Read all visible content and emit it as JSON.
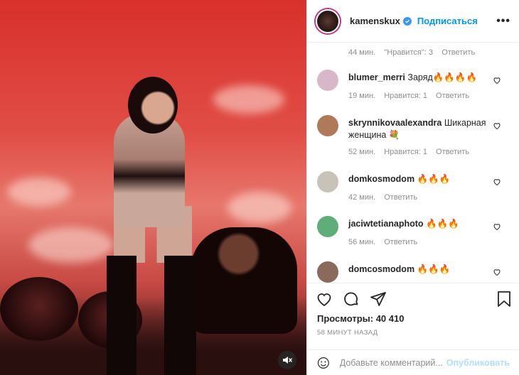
{
  "header": {
    "username": "kamenskux",
    "follow_label": "Подписаться",
    "more_label": "•••"
  },
  "comments_top_meta": {
    "time": "44 мин.",
    "likes": "\"Нравится\": 3",
    "reply": "Ответить"
  },
  "comments": [
    {
      "username": "blumer_merri",
      "text": "Заряд🔥🔥🔥🔥",
      "time": "19 мин.",
      "likes": "Нравится: 1",
      "reply": "Ответить",
      "avatar_color": "#d8b8c8"
    },
    {
      "username": "skrynnikovaalexandra",
      "text": "Шикарная женщина 💐",
      "time": "52 мин.",
      "likes": "Нравится: 1",
      "reply": "Ответить",
      "avatar_color": "#b07a5a"
    },
    {
      "username": "domkosmodom",
      "text": "🔥🔥🔥",
      "time": "42 мин.",
      "likes": "",
      "reply": "Ответить",
      "avatar_color": "#c9c2b8"
    },
    {
      "username": "jaciwtetianaphoto",
      "text": "🔥🔥🔥",
      "time": "56 мин.",
      "likes": "",
      "reply": "Ответить",
      "avatar_color": "#5fae7a"
    },
    {
      "username": "domcosmodom",
      "text": "🔥🔥🔥",
      "time": "",
      "likes": "",
      "reply": "",
      "avatar_color": "#8a6a5a"
    }
  ],
  "views": "Просмотры: 40 410",
  "time_ago": "58 МИНУТ НАЗАД",
  "comment_input": {
    "placeholder": "Добавьте комментарий..."
  },
  "publish_label": "Опубликовать",
  "colors": {
    "link": "#0095f6",
    "publish_disabled": "#b2dffc",
    "muted": "#8e8e8e"
  }
}
